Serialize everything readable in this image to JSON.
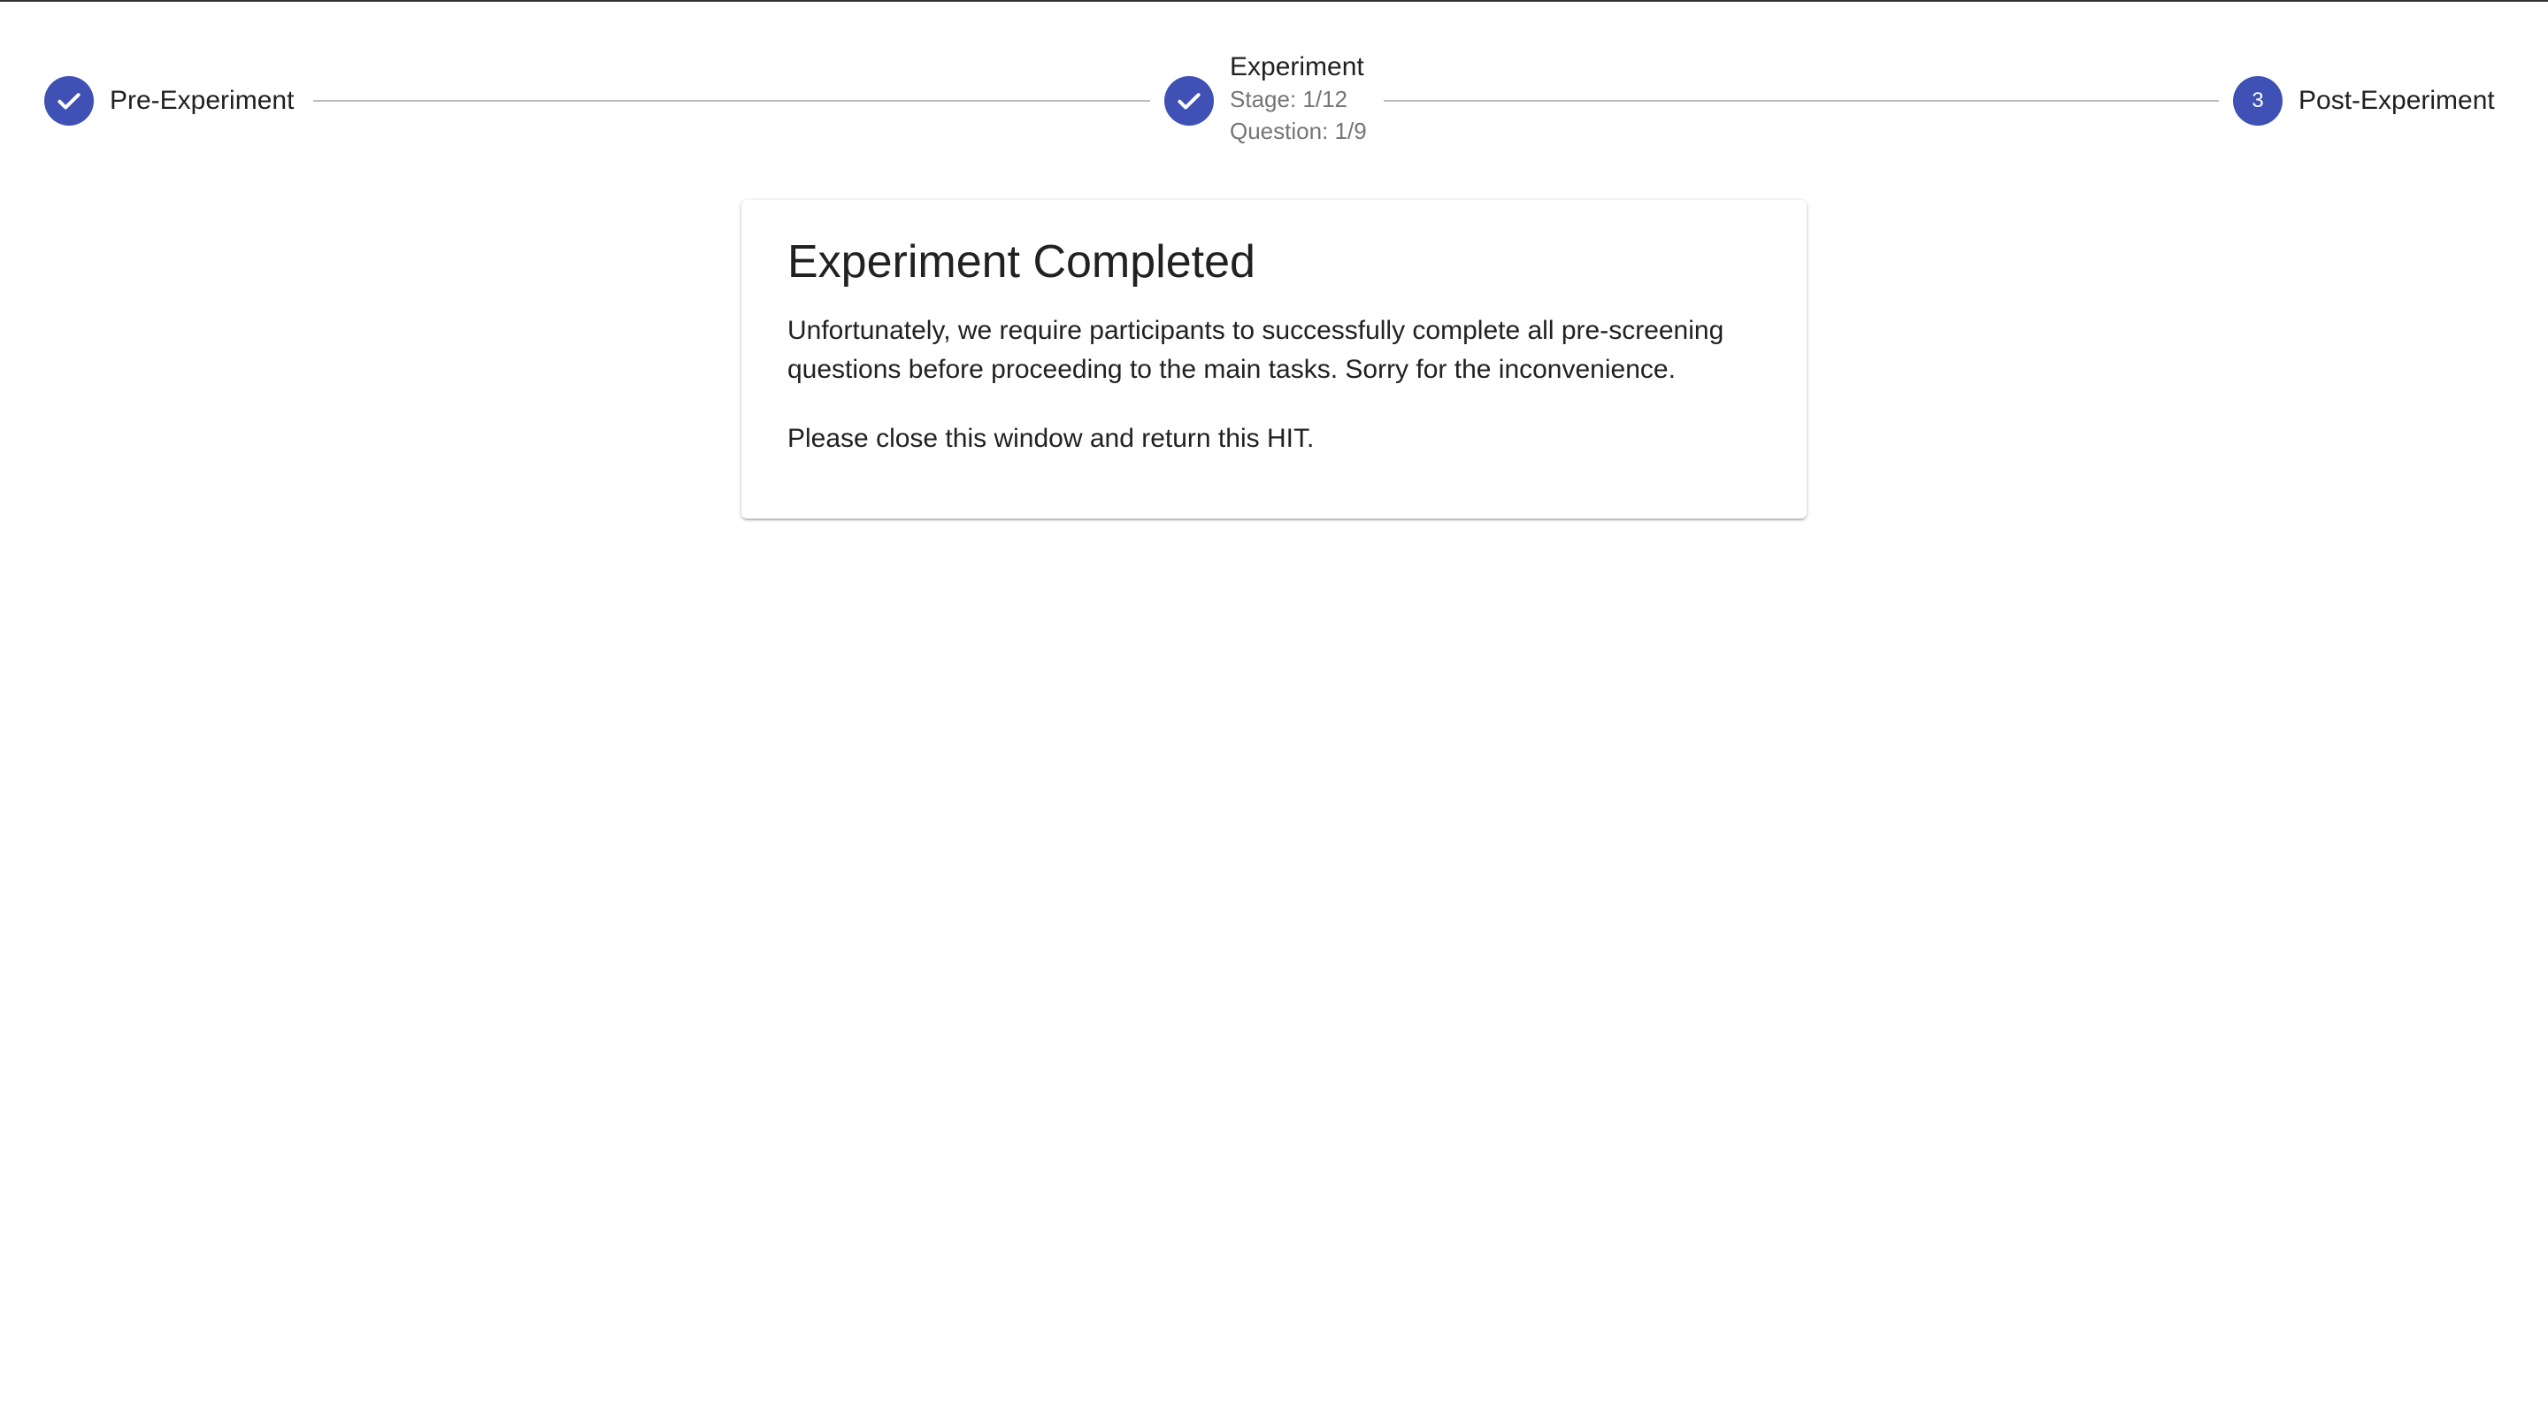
{
  "stepper": {
    "steps": [
      {
        "label": "Pre-Experiment",
        "status": "completed",
        "icon": "check-icon"
      },
      {
        "label": "Experiment",
        "status": "completed",
        "icon": "check-icon",
        "stage": "Stage: 1/12",
        "question": "Question: 1/9"
      },
      {
        "label": "Post-Experiment",
        "status": "pending",
        "number": "3"
      }
    ],
    "accent_color": "#3f51b5",
    "connector_color": "#bdbdbd"
  },
  "card": {
    "title": "Experiment Completed",
    "message": "Unfortunately, we require participants to successfully complete all pre-screening questions before proceeding to the main tasks. Sorry for the inconvenience.",
    "instruction": "Please close this window and return this HIT."
  }
}
